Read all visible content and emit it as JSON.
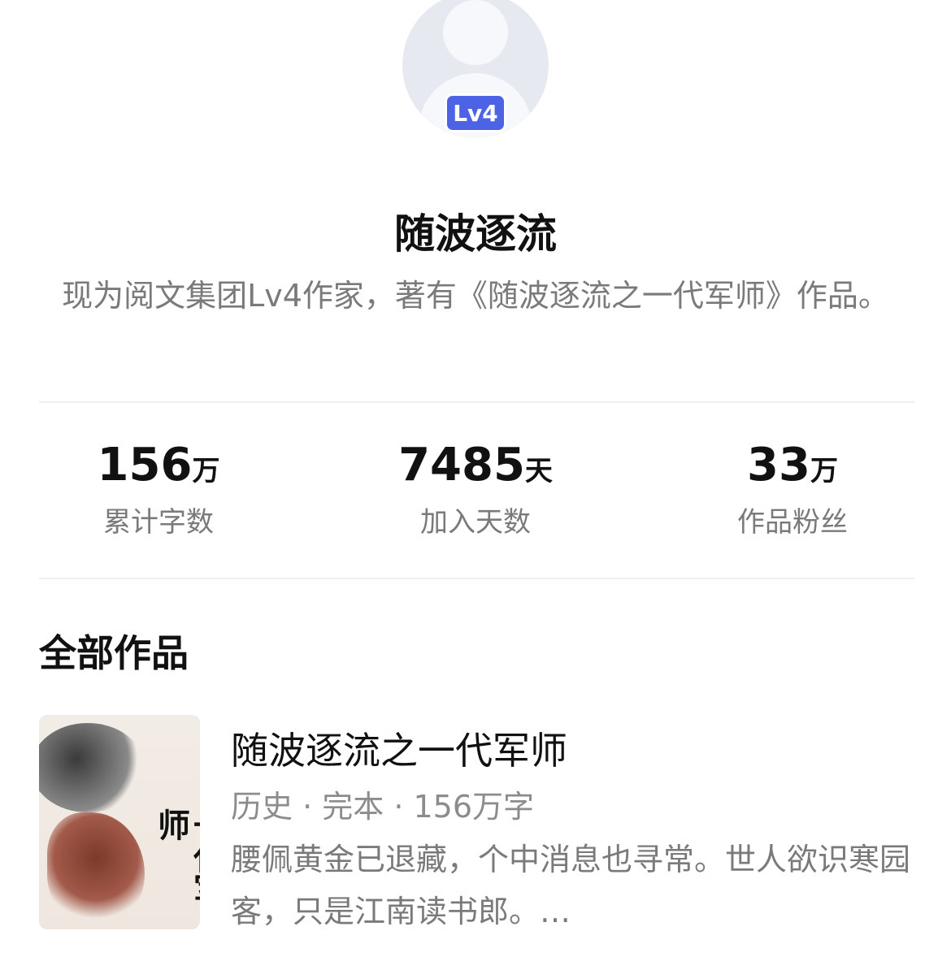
{
  "profile": {
    "level_badge": "Lv4",
    "name": "随波逐流",
    "bio": "现为阅文集团Lv4作家，著有《随波逐流之一代军师》作品。"
  },
  "stats": [
    {
      "value": "156",
      "unit": "万",
      "label": "累计字数"
    },
    {
      "value": "7485",
      "unit": "天",
      "label": "加入天数"
    },
    {
      "value": "33",
      "unit": "万",
      "label": "作品粉丝"
    }
  ],
  "works": {
    "section_title": "全部作品",
    "items": [
      {
        "title": "随波逐流之一代军师",
        "cover_text": "一代军师",
        "meta": "历史 · 完本 · 156万字",
        "description": "腰佩黄金已退藏，个中消息也寻常。世人欲识寒园客，只是江南读书郎。…"
      }
    ]
  },
  "colors": {
    "badge": "#4d63e6",
    "text_primary": "#111111",
    "text_secondary": "#7a7a7a",
    "divider": "#efefef"
  }
}
